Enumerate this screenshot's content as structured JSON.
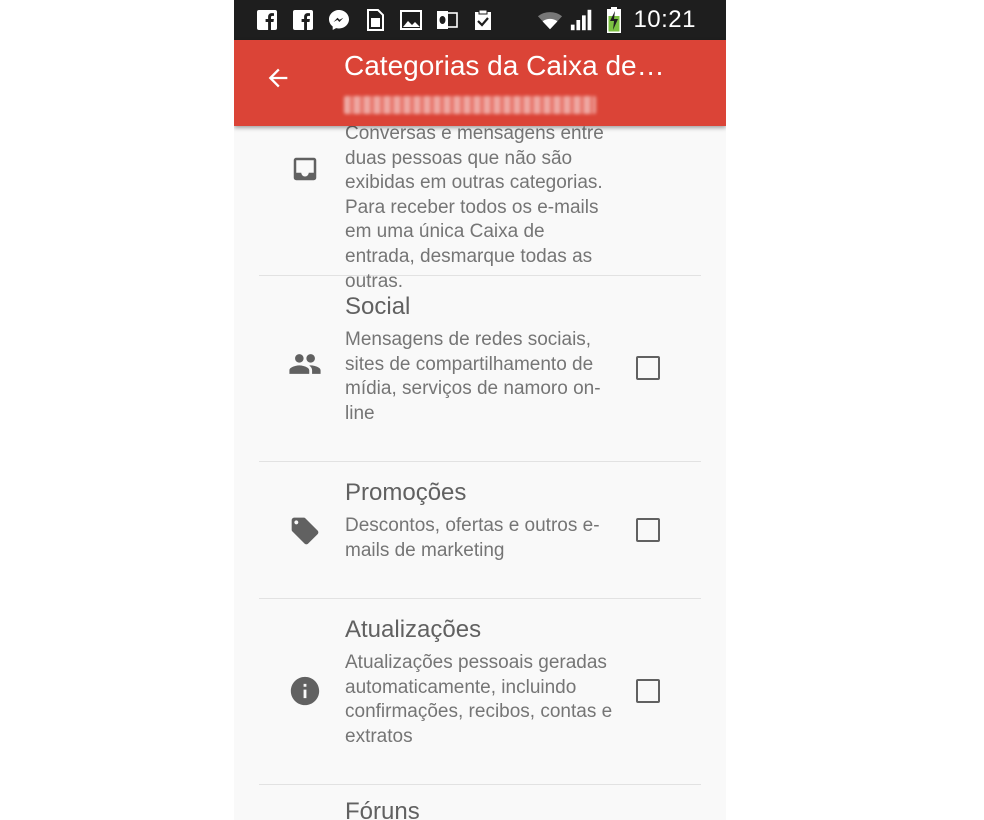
{
  "status_bar": {
    "time": "10:21",
    "icons": [
      "facebook-icon",
      "facebook-icon",
      "messenger-icon",
      "sim-card-icon",
      "image-icon",
      "outlook-icon",
      "clipboard-check-icon",
      "wifi-icon",
      "signal-icon",
      "battery-charging-icon"
    ]
  },
  "app_bar": {
    "title": "Categorias da Caixa de…",
    "back_icon": "arrow-back-icon",
    "color": "#db4437"
  },
  "categories": [
    {
      "icon": "inbox-icon",
      "name": "",
      "description": "Conversas e mensagens entre duas pessoas que não são exibidas em outras categorias. Para receber todos os e-mails em uma única Caixa de entrada, desmarque todas as outras.",
      "checked": false
    },
    {
      "icon": "people-icon",
      "name": "Social",
      "description": "Mensagens de redes sociais, sites de compartilhamento de mídia, serviços de namoro on-line",
      "checked": false
    },
    {
      "icon": "tag-icon",
      "name": "Promoções",
      "description": "Descontos, ofertas e outros e-mails de marketing",
      "checked": false
    },
    {
      "icon": "info-icon",
      "name": "Atualizações",
      "description": "Atualizações pessoais geradas automaticamente, incluindo confirmações, recibos, contas e extratos",
      "checked": false
    },
    {
      "name": "Fóruns"
    }
  ]
}
